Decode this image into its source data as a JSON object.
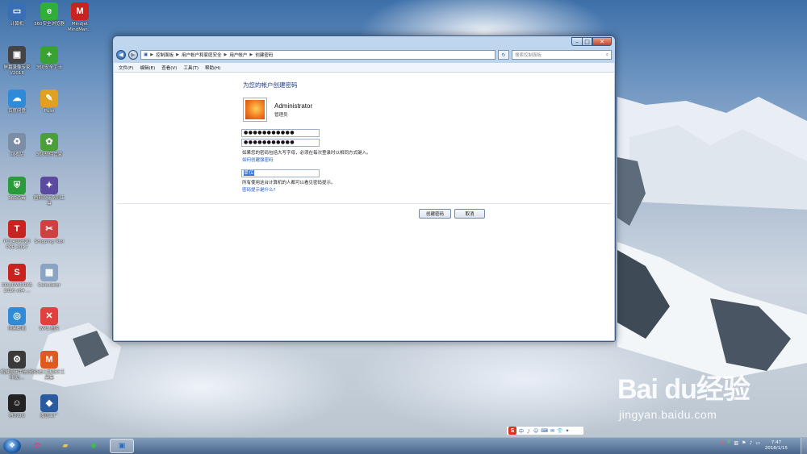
{
  "desktop": {
    "icons": [
      {
        "label": "计算机",
        "color": "#3b6fb5",
        "glyph": "▭"
      },
      {
        "label": "360安全浏览器",
        "color": "#2fae3a",
        "glyph": "e"
      },
      {
        "label": "Mindjet MindMan...",
        "color": "#c8231f",
        "glyph": "M"
      },
      {
        "label": "屏幕录像专家 V2018",
        "color": "#444444",
        "glyph": "▣"
      },
      {
        "label": "360安全卫士",
        "color": "#3aa234",
        "glyph": "+"
      },
      {
        "label": "百度网盘",
        "color": "#2f8ad8",
        "glyph": "☁"
      },
      {
        "label": "Pulsi",
        "color": "#e0a020",
        "glyph": "✎"
      },
      {
        "label": "回收站",
        "color": "#7b8ea5",
        "glyph": "♻"
      },
      {
        "label": "360软件管家",
        "color": "#4a9f3a",
        "glyph": "✿"
      },
      {
        "label": "360杀毒",
        "color": "#2a9a3a",
        "glyph": "⛨"
      },
      {
        "label": "图形设计系列工具",
        "color": "#5c4aa0",
        "glyph": "✦"
      },
      {
        "label": "PCCAD2020 PCR 2017",
        "color": "#c8231f",
        "glyph": "T"
      },
      {
        "label": "Snipping Tool",
        "color": "#d04040",
        "glyph": "✂"
      },
      {
        "label": "SOLIDWORKS 2016 x64 ...",
        "color": "#c8231f",
        "glyph": "S"
      },
      {
        "label": "Calculator",
        "color": "#8aa4c4",
        "glyph": "▦"
      },
      {
        "label": "网易邮箱",
        "color": "#2f8ad8",
        "glyph": "◎"
      },
      {
        "label": "WPS 图片",
        "color": "#e04040",
        "glyph": "✕"
      },
      {
        "label": "机械设计手册(软件版)...",
        "color": "#3a3a3a",
        "glyph": "⚙"
      },
      {
        "label": "迈迪三维设计工具集",
        "color": "#e05a20",
        "glyph": "M"
      },
      {
        "label": "腾讯QQ",
        "color": "#222222",
        "glyph": "☺"
      },
      {
        "label": "魔兽工厂",
        "color": "#2a5aa0",
        "glyph": "◆"
      }
    ]
  },
  "window": {
    "controls": {
      "minimize": "–",
      "maximize": "□",
      "close": "✕"
    },
    "address": {
      "crumbs": [
        "控制面板",
        "用户帐户和家庭安全",
        "用户帐户",
        "创建密码"
      ],
      "search_placeholder": "搜索控制面板"
    },
    "menu": [
      "文件(F)",
      "编辑(E)",
      "查看(V)",
      "工具(T)",
      "帮助(H)"
    ],
    "content": {
      "title": "为您的帐户创建密码",
      "account_name": "Administrator",
      "account_role": "管理员",
      "password_value": "●●●●●●●●●●●",
      "confirm_value": "●●●●●●●●●●●",
      "caps_info": "如果您的密码包括大写字母，必须在每次登录时以相同方式键入。",
      "strong_password_link": "如何创建强密码",
      "hint_value": "单位",
      "hint_info": "所有使用这台计算机的人都可以看见密码提示。",
      "hint_link": "密码提示是什么?",
      "create_button": "创建密码",
      "cancel_button": "取消"
    }
  },
  "taskbar": {
    "clock_time": "7:47",
    "clock_date": "2018/1/15",
    "ime": [
      "S",
      "中",
      "丿",
      "☺",
      "⌨",
      "✉",
      "👕",
      "✦"
    ]
  },
  "watermark": {
    "logo": "Bai du经验",
    "url": "jingyan.baidu.com"
  }
}
